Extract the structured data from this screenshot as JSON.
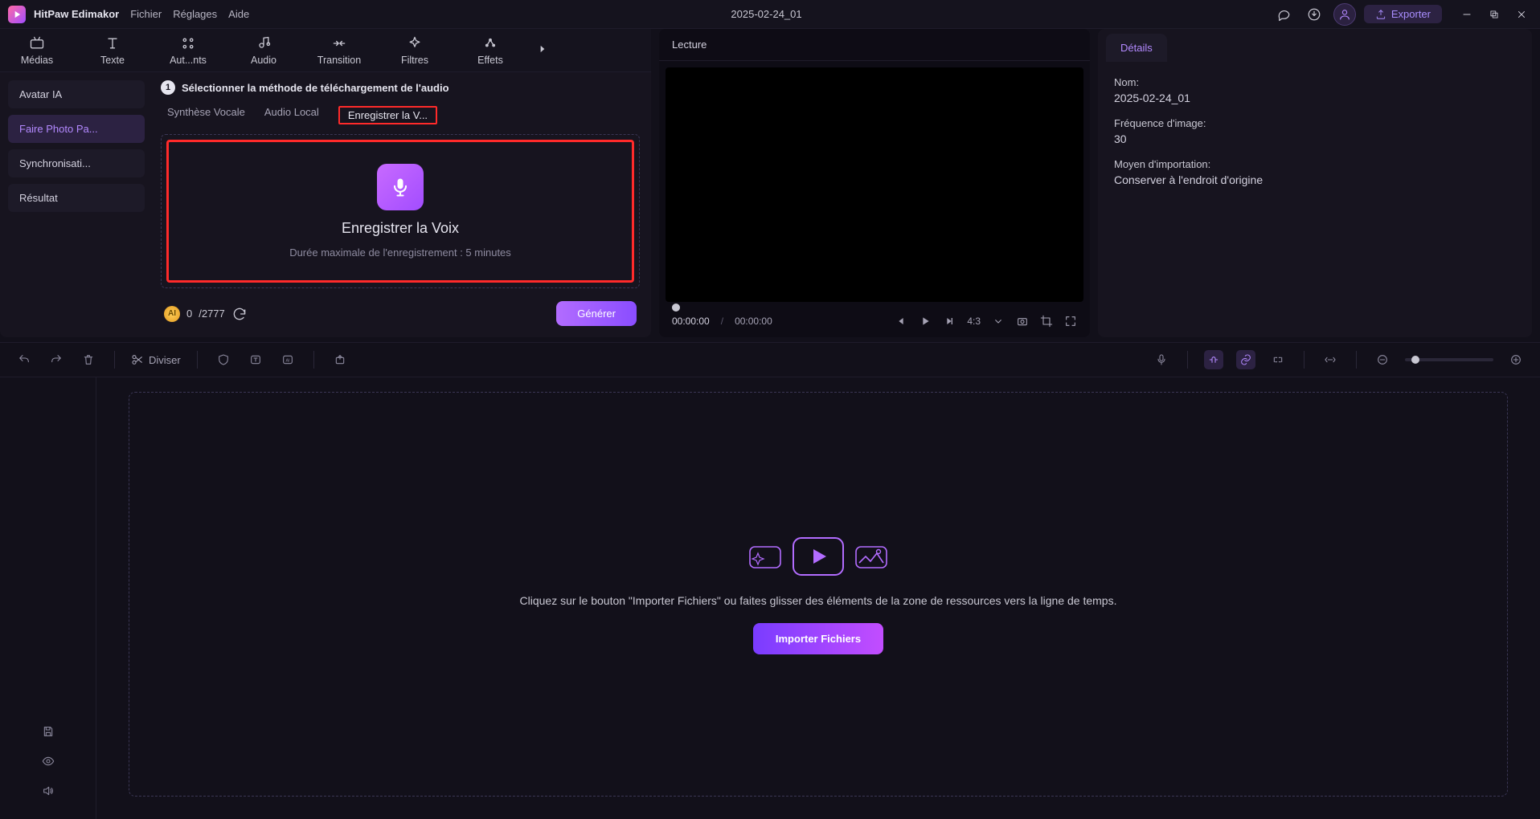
{
  "app": {
    "name": "HitPaw Edimakor",
    "menus": [
      "Fichier",
      "Réglages",
      "Aide"
    ],
    "project_title": "2025-02-24_01",
    "export_label": "Exporter"
  },
  "toolbar": {
    "items": [
      {
        "label": "Médias",
        "icon": "media"
      },
      {
        "label": "Texte",
        "icon": "text"
      },
      {
        "label": "Aut...nts",
        "icon": "sticker"
      },
      {
        "label": "Audio",
        "icon": "audio"
      },
      {
        "label": "Transition",
        "icon": "transition"
      },
      {
        "label": "Filtres",
        "icon": "filter"
      },
      {
        "label": "Effets",
        "icon": "effect"
      }
    ]
  },
  "sidebar": {
    "items": [
      {
        "label": "Avatar IA"
      },
      {
        "label": "Faire Photo Pa..."
      },
      {
        "label": "Synchronisati..."
      },
      {
        "label": "Résultat"
      }
    ],
    "active_index": 1
  },
  "step": {
    "number": "1",
    "title": "Sélectionner la méthode de téléchargement de l'audio"
  },
  "subtabs": {
    "items": [
      "Synthèse Vocale",
      "Audio Local",
      "Enregistrer la V..."
    ],
    "active_index": 2
  },
  "record": {
    "title": "Enregistrer la Voix",
    "subtitle": "Durée maximale de l'enregistrement : 5 minutes"
  },
  "credits": {
    "used": "0",
    "total": "/2777",
    "generate_label": "Générer"
  },
  "preview": {
    "header": "Lecture",
    "time_current": "00:00:00",
    "time_total": "00:00:00",
    "aspect": "4:3"
  },
  "details": {
    "tab_label": "Détails",
    "name_label": "Nom:",
    "name_value": "2025-02-24_01",
    "fps_label": "Fréquence d'image:",
    "fps_value": "30",
    "import_label": "Moyen d'importation:",
    "import_value": "Conserver à l'endroit d'origine"
  },
  "timeline_toolbar": {
    "split_label": "Diviser"
  },
  "timeline_drop": {
    "hint": "Cliquez sur le bouton \"Importer Fichiers\" ou faites glisser des éléments de la zone de ressources vers la ligne de temps.",
    "button": "Importer Fichiers"
  }
}
